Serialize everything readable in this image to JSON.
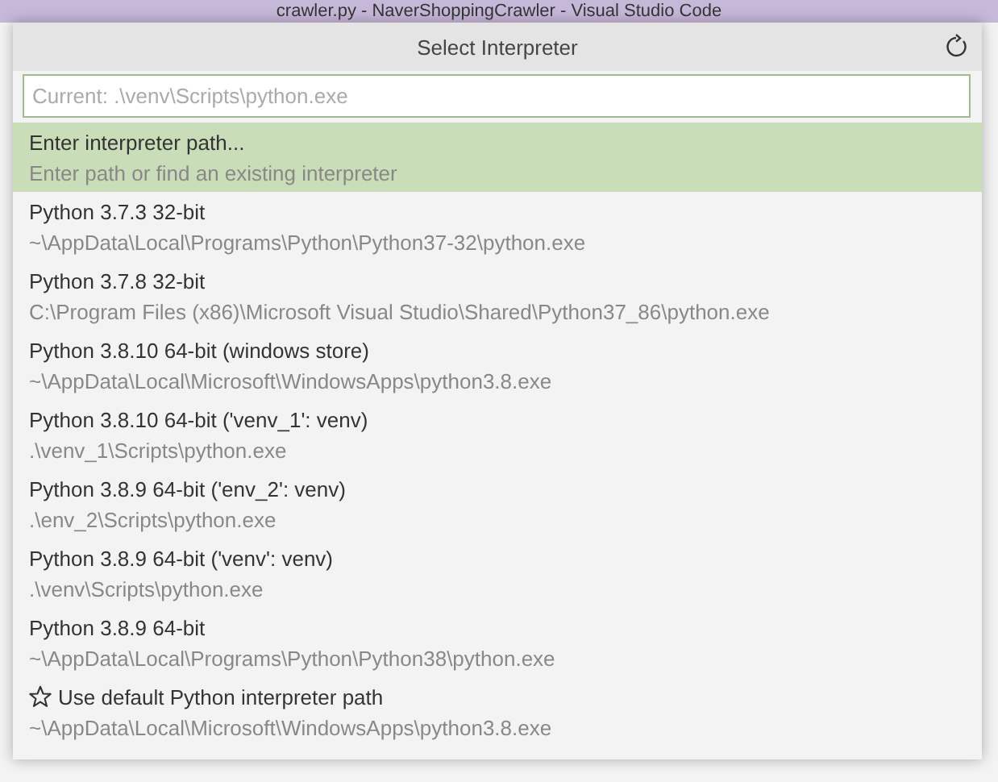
{
  "window": {
    "title": "crawler.py - NaverShoppingCrawler - Visual Studio Code"
  },
  "picker": {
    "title": "Select Interpreter",
    "placeholder": "Current: .\\venv\\Scripts\\python.exe",
    "items": [
      {
        "kind": "plain",
        "label": "Enter interpreter path...",
        "description": "Enter path or find an existing interpreter",
        "selected": true
      },
      {
        "kind": "plain",
        "label": "Python 3.7.3 32-bit",
        "description": "~\\AppData\\Local\\Programs\\Python\\Python37-32\\python.exe",
        "selected": false
      },
      {
        "kind": "plain",
        "label": "Python 3.7.8 32-bit",
        "description": "C:\\Program Files (x86)\\Microsoft Visual Studio\\Shared\\Python37_86\\python.exe",
        "selected": false
      },
      {
        "kind": "plain",
        "label": "Python 3.8.10 64-bit (windows store)",
        "description": "~\\AppData\\Local\\Microsoft\\WindowsApps\\python3.8.exe",
        "selected": false
      },
      {
        "kind": "plain",
        "label": "Python 3.8.10 64-bit ('venv_1': venv)",
        "description": ".\\venv_1\\Scripts\\python.exe",
        "selected": false
      },
      {
        "kind": "plain",
        "label": "Python 3.8.9 64-bit ('env_2': venv)",
        "description": ".\\env_2\\Scripts\\python.exe",
        "selected": false
      },
      {
        "kind": "plain",
        "label": "Python 3.8.9 64-bit ('venv': venv)",
        "description": ".\\venv\\Scripts\\python.exe",
        "selected": false
      },
      {
        "kind": "plain",
        "label": "Python 3.8.9 64-bit",
        "description": "~\\AppData\\Local\\Programs\\Python\\Python38\\python.exe",
        "selected": false
      },
      {
        "kind": "star",
        "label": "Use default Python interpreter path",
        "description": "~\\AppData\\Local\\Microsoft\\WindowsApps\\python3.8.exe",
        "selected": false
      }
    ]
  }
}
